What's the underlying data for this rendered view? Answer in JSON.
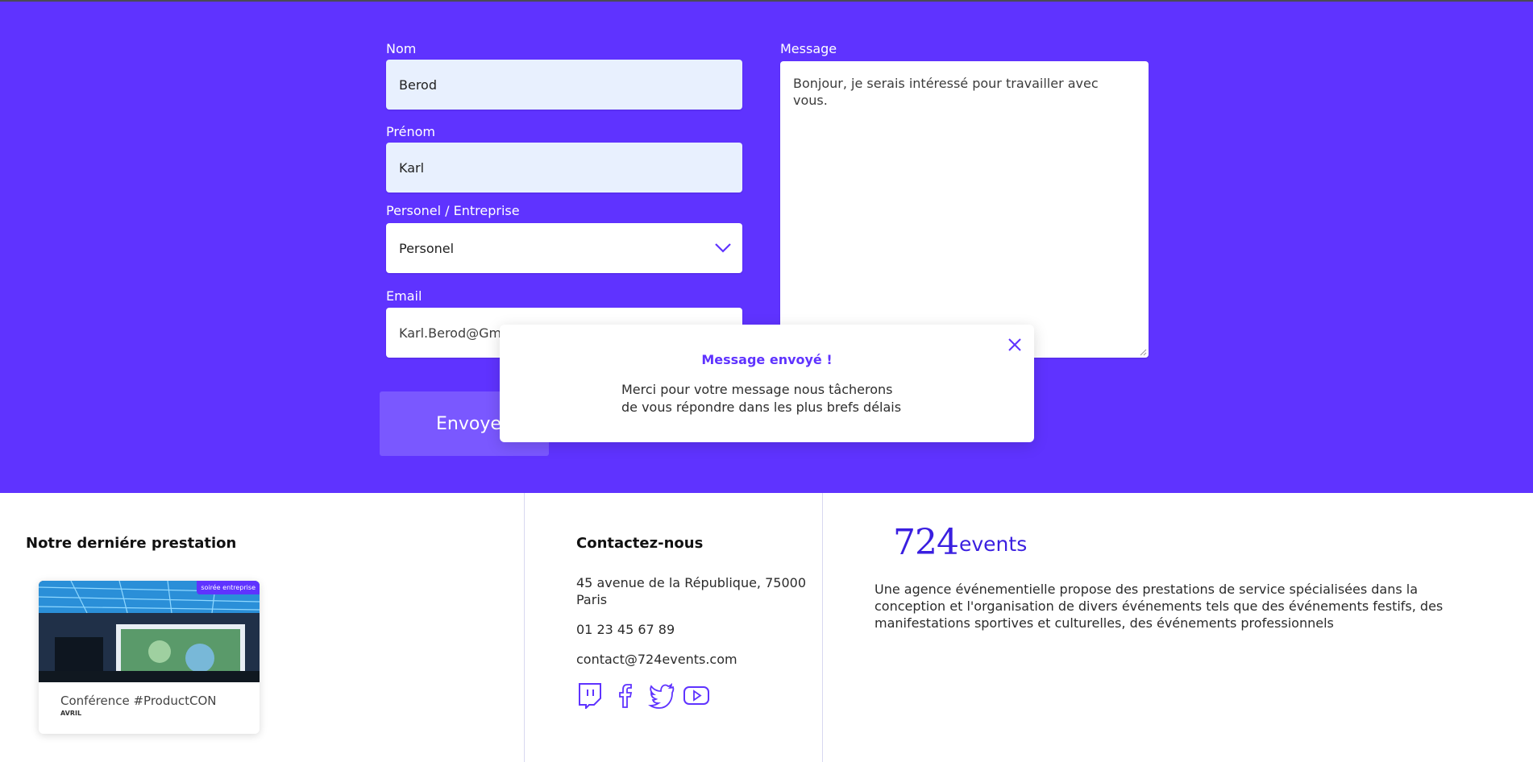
{
  "form": {
    "nom_label": "Nom",
    "nom_value": "Berod",
    "prenom_label": "Prénom",
    "prenom_value": "Karl",
    "type_label": "Personel / Entreprise",
    "type_value": "Personel",
    "email_label": "Email",
    "email_value": "Karl.Berod@Gmai",
    "message_label": "Message",
    "message_value": "Bonjour, je serais intéressé pour travailler avec vous.",
    "send_label": "Envoyer"
  },
  "modal": {
    "title": "Message envoyé !",
    "body": "Merci pour votre message nous tâcherons de vous répondre dans les plus brefs délais"
  },
  "footer": {
    "latest": {
      "heading": "Notre derniére prestation",
      "badge": "soirée entreprise",
      "title": "Conférence #ProductCON",
      "subtitle": "AVRIL"
    },
    "contact": {
      "heading": "Contactez-nous",
      "address": "45 avenue de la République, 75000 Paris",
      "phone": "01 23 45 67 89",
      "email": "contact@724events.com"
    },
    "brand": {
      "number": "724",
      "word": "events",
      "description": "Une agence événementielle propose des prestations de service spécialisées dans la conception et l'organisation de divers événements tels que des événements festifs, des manifestations sportives et culturelles, des événements professionnels"
    },
    "social_icons": [
      "twitch-icon",
      "facebook-icon",
      "twitter-icon",
      "youtube-icon"
    ]
  },
  "colors": {
    "accent": "#5f33ff",
    "field_fill": "#e8f0fe",
    "logo": "#3a1fe0"
  }
}
